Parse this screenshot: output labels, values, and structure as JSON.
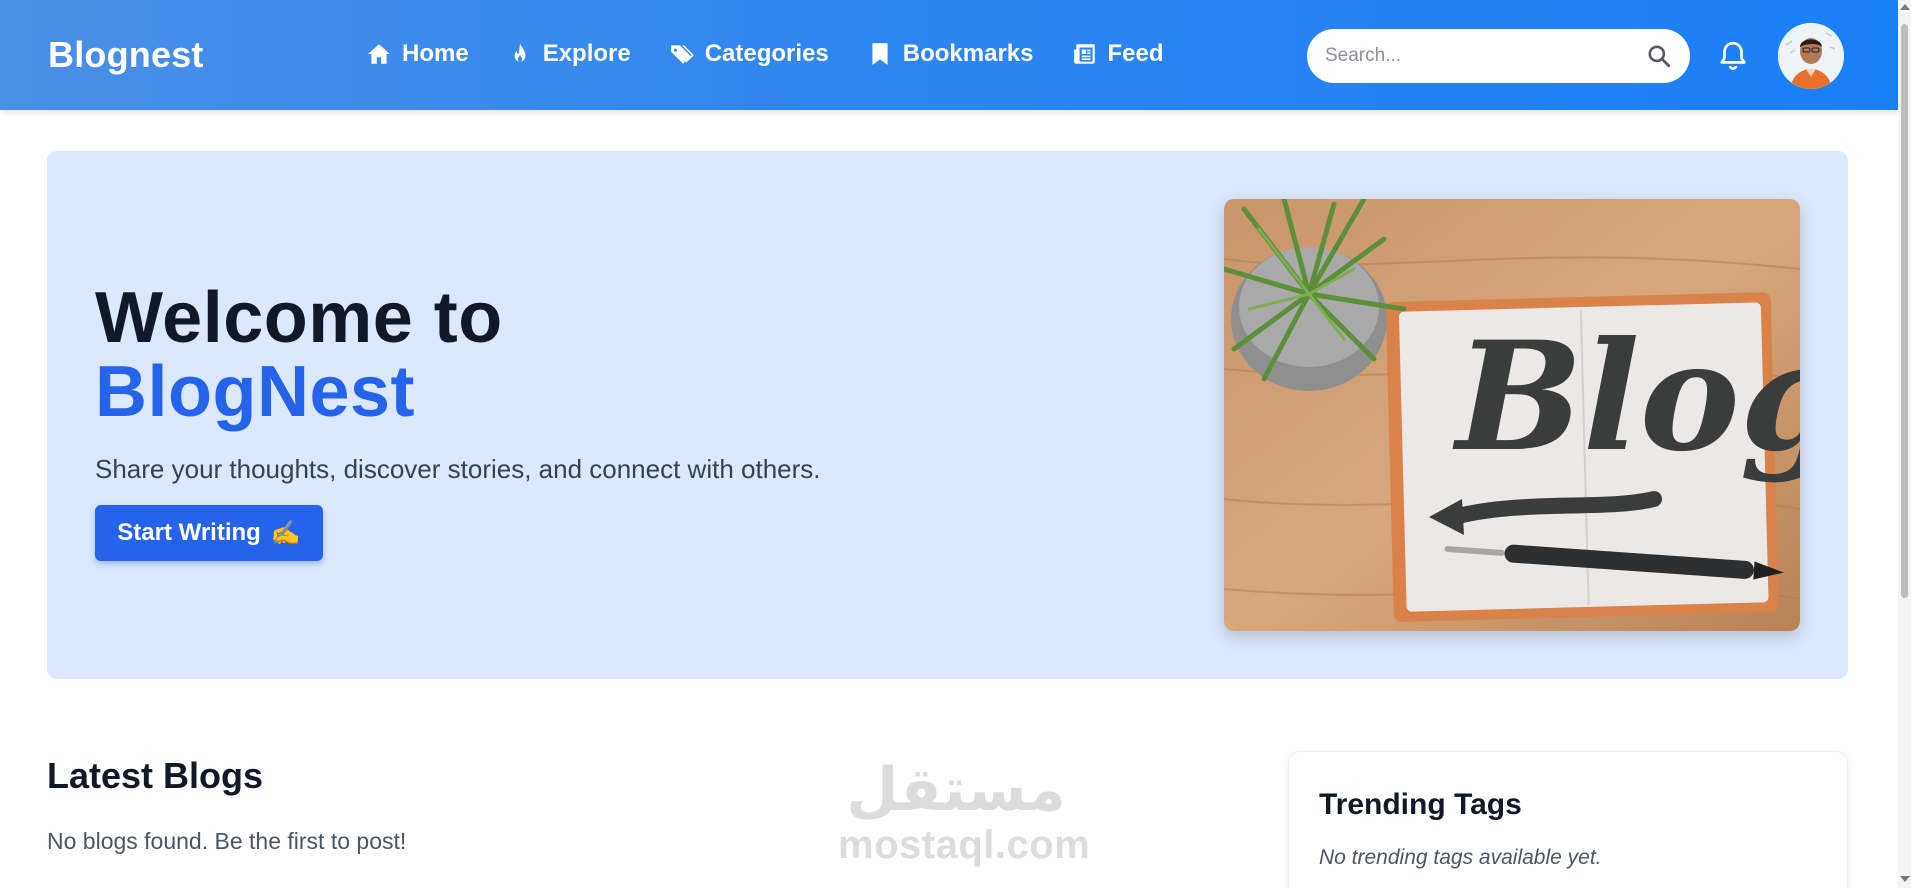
{
  "header": {
    "brand": "Blognest",
    "nav": [
      {
        "label": "Home",
        "icon": "home-icon"
      },
      {
        "label": "Explore",
        "icon": "flame-icon"
      },
      {
        "label": "Categories",
        "icon": "tags-icon"
      },
      {
        "label": "Bookmarks",
        "icon": "bookmark-icon"
      },
      {
        "label": "Feed",
        "icon": "newspaper-icon"
      }
    ],
    "search_placeholder": "Search...",
    "colors": {
      "gradient_start": "#4a8fe6",
      "gradient_end": "#1a80f7"
    }
  },
  "hero": {
    "title_line1": "Welcome to",
    "title_line2": "BlogNest",
    "subtitle": "Share your thoughts, discover stories, and connect with others.",
    "cta_label": "Start Writing",
    "cta_emoji": "✍️",
    "image_text": "Blog",
    "colors": {
      "background": "#dbe8fd",
      "accent": "#2563eb"
    }
  },
  "latest": {
    "title": "Latest Blogs",
    "empty_message": "No blogs found. Be the first to post!"
  },
  "trending": {
    "title": "Trending Tags",
    "empty_message": "No trending tags available yet."
  },
  "watermark": {
    "arabic": "مستقل",
    "text": "mostaql.com"
  }
}
